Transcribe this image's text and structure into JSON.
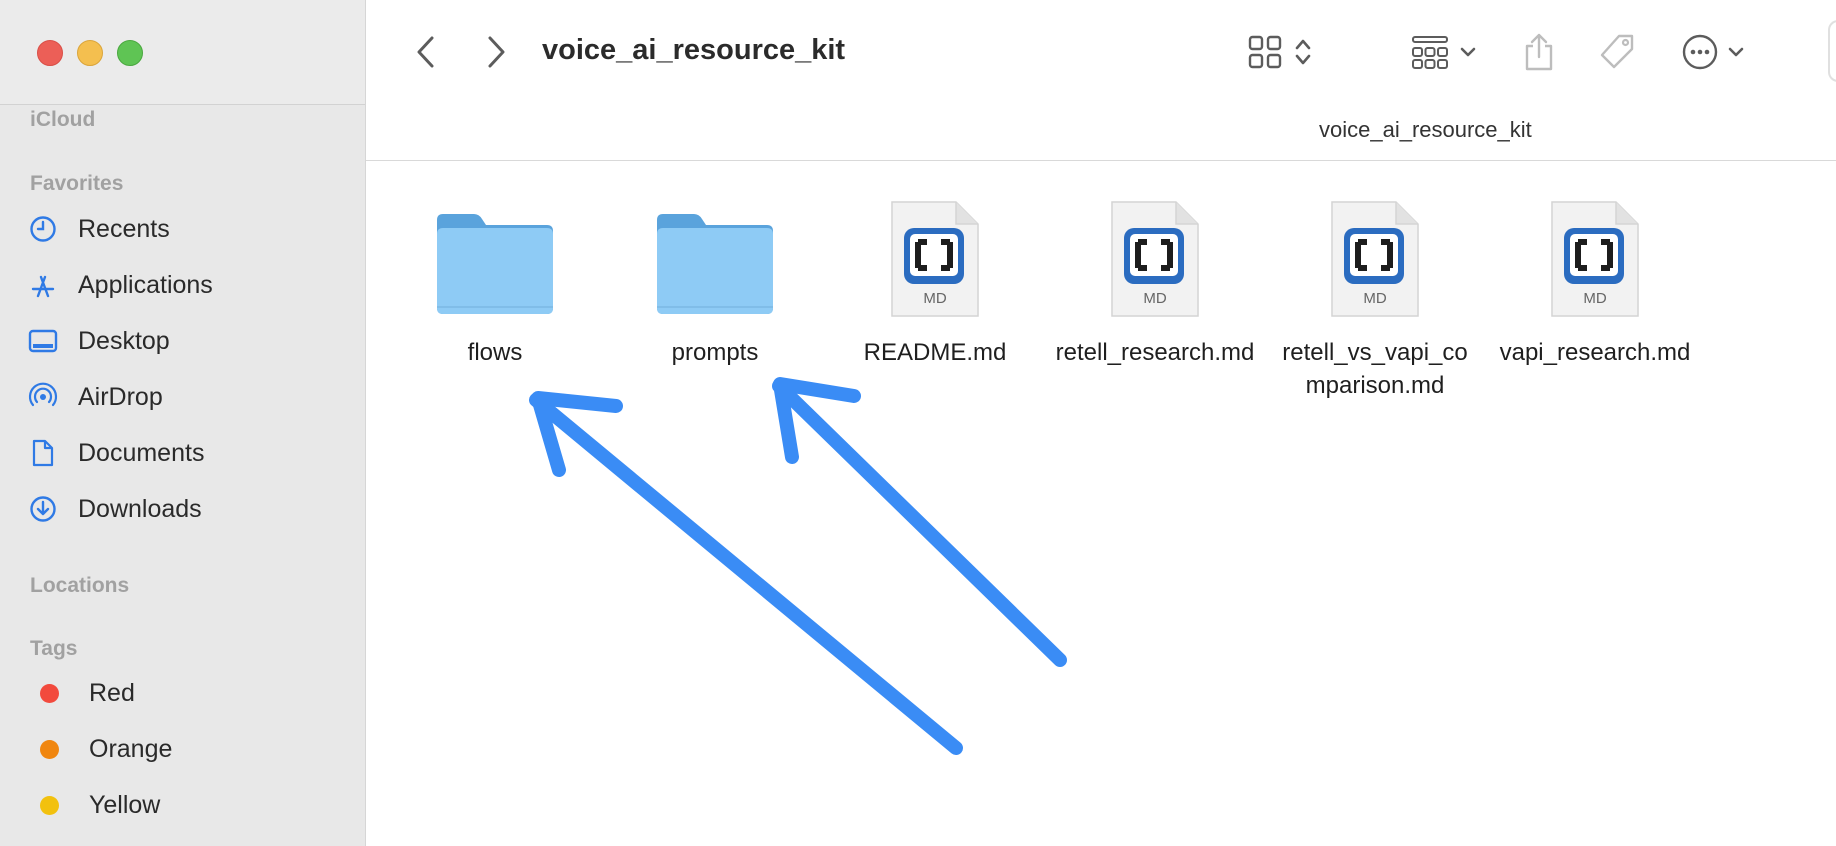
{
  "window": {
    "title": "voice_ai_resource_kit",
    "path_title": "voice_ai_resource_kit"
  },
  "sidebar": {
    "icloud_label": "iCloud",
    "favorites_label": "Favorites",
    "favorites": [
      {
        "label": "Recents",
        "icon": "clock-icon"
      },
      {
        "label": "Applications",
        "icon": "applications-icon"
      },
      {
        "label": "Desktop",
        "icon": "desktop-icon"
      },
      {
        "label": "AirDrop",
        "icon": "airdrop-icon"
      },
      {
        "label": "Documents",
        "icon": "document-icon"
      },
      {
        "label": "Downloads",
        "icon": "download-icon"
      }
    ],
    "locations_label": "Locations",
    "tags_label": "Tags",
    "tags": [
      {
        "label": "Red",
        "color": "#f24a3d"
      },
      {
        "label": "Orange",
        "color": "#f0860f"
      },
      {
        "label": "Yellow",
        "color": "#f2c10e"
      }
    ]
  },
  "toolbar": {
    "icons": [
      "chevron-left-icon",
      "chevron-right-icon",
      "icon-view-icon",
      "group-icon",
      "share-icon",
      "tag-icon",
      "more-icon"
    ]
  },
  "files": [
    {
      "name": "flows",
      "kind": "folder"
    },
    {
      "name": "prompts",
      "kind": "folder"
    },
    {
      "name": "README.md",
      "kind": "md",
      "badge": "MD"
    },
    {
      "name": "retell_research.md",
      "kind": "md",
      "badge": "MD"
    },
    {
      "name": "retell_vs_vapi_comparison.md",
      "kind": "md",
      "badge": "MD"
    },
    {
      "name": "vapi_research.md",
      "kind": "md",
      "badge": "MD"
    }
  ],
  "colors": {
    "accent": "#3a8cf5",
    "folder": "#8ecbf5",
    "sidebar_bg": "#e8e8e8"
  },
  "annotations": {
    "arrows": [
      "annotation-arrow-to-flows",
      "annotation-arrow-to-prompts"
    ]
  }
}
